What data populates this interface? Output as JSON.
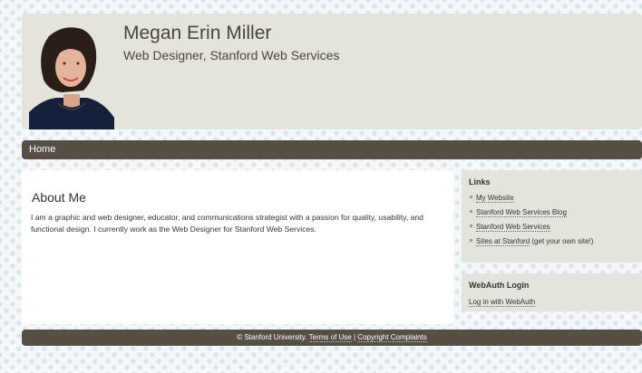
{
  "header": {
    "name": "Megan Erin Miller",
    "slogan": "Web Designer, Stanford Web Services"
  },
  "nav": {
    "home": "Home"
  },
  "main": {
    "title": "About Me",
    "body": "I am a graphic and web designer, educator, and communications strategist with a passion for quality, usability, and functional design. I currently work as the Web Designer for Stanford Web Services."
  },
  "sidebar": {
    "links_title": "Links",
    "links": [
      {
        "label": "My Website"
      },
      {
        "label": "Stanford Web Services Blog"
      },
      {
        "label": "Stanford Web Services"
      },
      {
        "label": "Sites at Stanford",
        "suffix": " (get your own site!)"
      }
    ],
    "webauth_title": "WebAuth Login",
    "webauth_link": "Log in with WebAuth"
  },
  "footer": {
    "copyright": "© Stanford University.",
    "terms": "Terms of Use",
    "separator": "|",
    "complaints": "Copyright Complaints"
  },
  "colors": {
    "header_bg": "#e5e4dc",
    "nav_bg": "#554f46",
    "page_bg": "#f4f8fa"
  }
}
